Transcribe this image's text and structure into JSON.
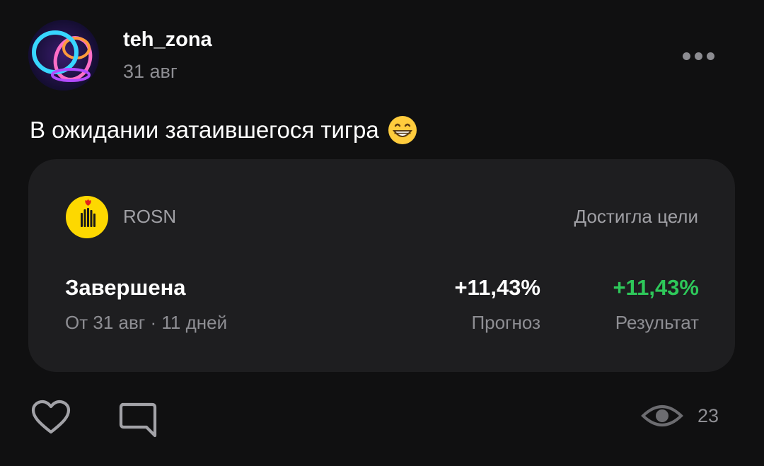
{
  "author": {
    "name": "teh_zona",
    "date": "31 авг",
    "avatar_icon": "neon-rings-avatar"
  },
  "post": {
    "text": "В ожидании затаившегося тигра",
    "emoji": "grinning-face-emoji"
  },
  "idea_card": {
    "ticker": "ROSN",
    "logo_icon": "rosneft-logo",
    "status": "Достигла цели",
    "state_title": "Завершена",
    "state_subtitle": "От 31 авг · 11 дней",
    "forecast_value": "+11,43%",
    "forecast_label": "Прогноз",
    "result_value": "+11,43%",
    "result_label": "Результат"
  },
  "actions": {
    "like_icon": "heart-icon",
    "comment_icon": "comment-icon",
    "views_icon": "eye-icon",
    "views_count": "23"
  },
  "colors": {
    "background": "#101011",
    "card": "#1e1e20",
    "positive": "#2ec85a",
    "logo_yellow": "#fdd800",
    "muted_text": "#8e8e93"
  }
}
